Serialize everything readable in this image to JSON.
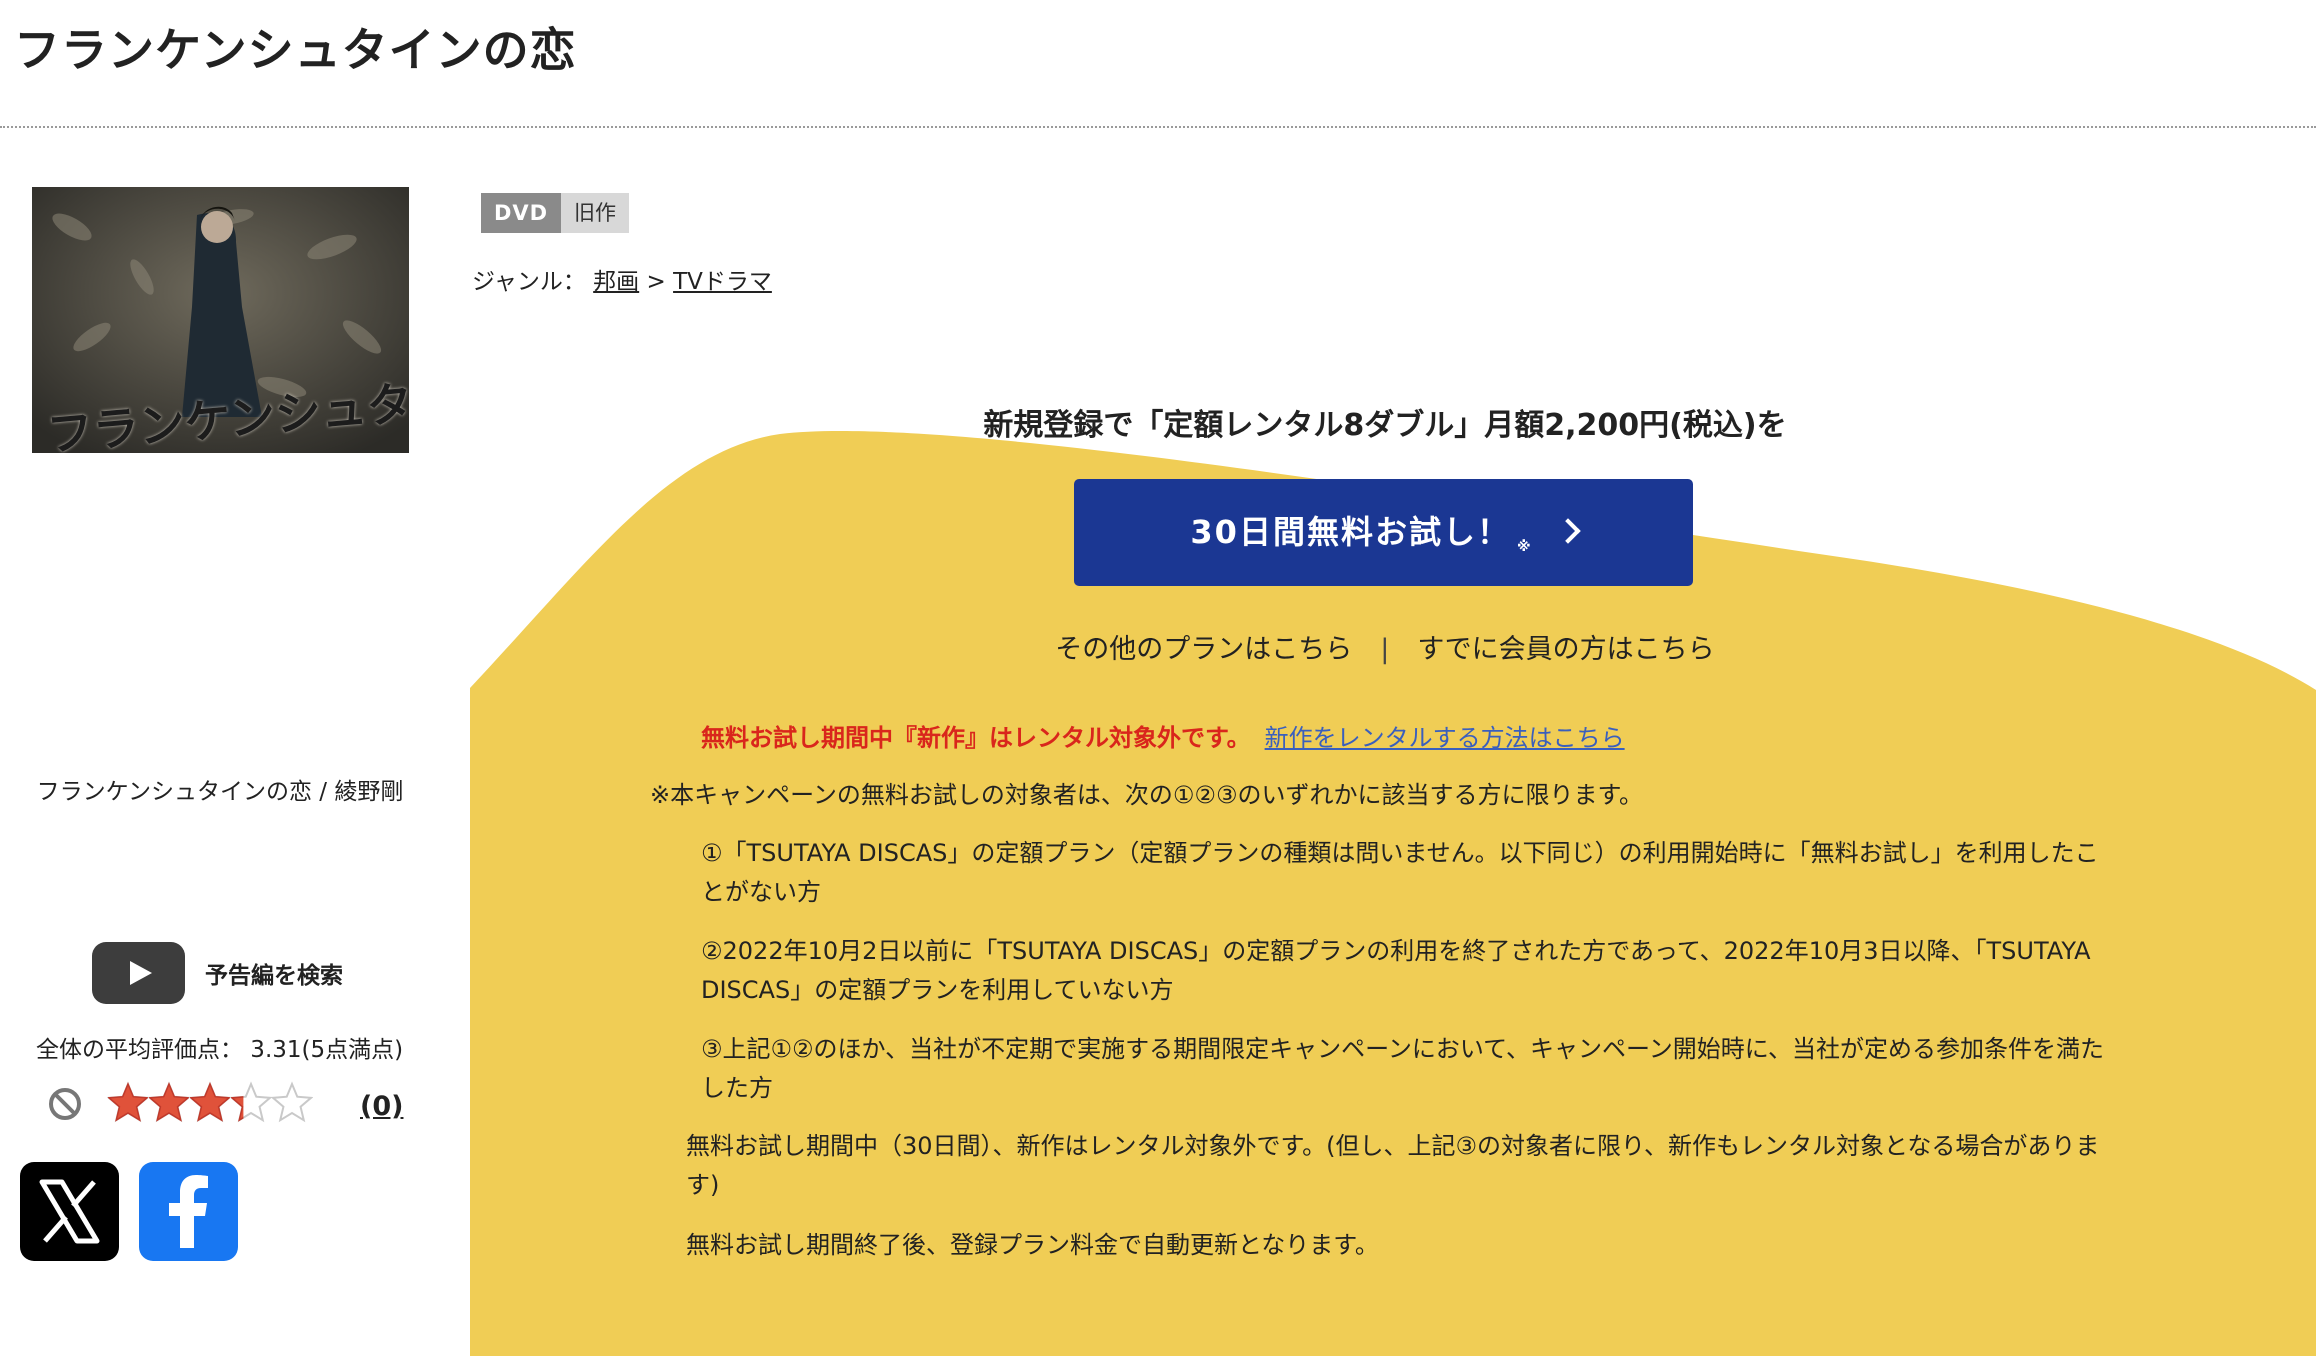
{
  "page": {
    "title": "フランケンシュタインの恋"
  },
  "left": {
    "cover_logo": "フランケンシュタインの恋",
    "caption": "フランケンシュタインの恋 / 綾野剛",
    "trailer_label": "予告編を検索",
    "rating_text": "全体の平均評価点： 3.31(5点満点)",
    "rating_value": 3.31,
    "rating_max": 5,
    "review_count": "(0)",
    "colors": {
      "star": "#e0523a",
      "x": "#000000",
      "facebook": "#1877f2"
    }
  },
  "tags": {
    "format": "DVD",
    "type": "旧作"
  },
  "genre": {
    "prefix": "ジャンル： ",
    "crumb1": "邦画",
    "sep": " > ",
    "crumb2": "TVドラマ"
  },
  "promo": {
    "headline": "新規登録で「定額レンタル8ダブル」月額2,200円(税込)を",
    "cta_label": "30日間無料お試し！",
    "cta_note": "※",
    "other_plans": "その他のプランはこちら",
    "separator": "|",
    "members": "すでに会員の方はこちら",
    "warning": "無料お試し期間中『新作』はレンタル対象外です。",
    "warning_link": "新作をレンタルする方法はこちら",
    "note_main": "※本キャンペーンの無料お試しの対象者は、次の①②③のいずれかに該当する方に限ります。",
    "cond1": "①「TSUTAYA DISCAS」の定額プラン（定額プランの種類は問いません。以下同じ）の利用開始時に「無料お試し」を利用したことがない方",
    "cond2": "②2022年10月2日以前に「TSUTAYA DISCAS」の定額プランの利用を終了された方であって、2022年10月3日以降、「TSUTAYA DISCAS」の定額プランを利用していない方",
    "cond3": "③上記①②のほか、当社が不定期で実施する期間限定キャンペーンにおいて、キャンペーン開始時に、当社が定める参加条件を満たした方",
    "trial_note": "無料お試し期間中（30日間）、新作はレンタル対象外です。(但し、上記③の対象者に限り、新作もレンタル対象となる場合があります)",
    "auto_renew": "無料お試し期間終了後、登録プラン料金で自動更新となります。",
    "colors": {
      "yellow": "#f0cd55",
      "cta": "#1b3793",
      "warning": "#d9261c",
      "link": "#3a5fbd"
    }
  }
}
